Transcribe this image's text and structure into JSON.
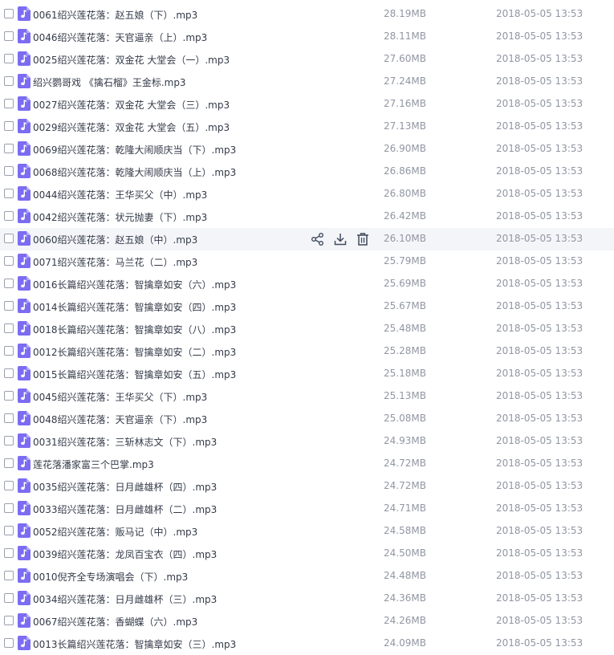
{
  "colors": {
    "icon_purple": "#7b6cf2",
    "text_primary": "#333a48",
    "text_secondary": "#9196a2",
    "hover_row": "#f4f5f9"
  },
  "icons": {
    "file": "audio-file-icon",
    "share": "share-icon",
    "download": "download-icon",
    "delete": "trash-icon"
  },
  "files": [
    {
      "name": "0061绍兴莲花落：赵五娘（下）.mp3",
      "size": "28.19MB",
      "date": "2018-05-05 13:53"
    },
    {
      "name": "0046绍兴莲花落：天官逼亲（上）.mp3",
      "size": "28.11MB",
      "date": "2018-05-05 13:53"
    },
    {
      "name": "0025绍兴莲花落：双金花  大堂会（一）.mp3",
      "size": "27.60MB",
      "date": "2018-05-05 13:53"
    },
    {
      "name": "绍兴鹦哥戏 《擒石榴》王金标.mp3",
      "size": "27.24MB",
      "date": "2018-05-05 13:53"
    },
    {
      "name": "0027绍兴莲花落：双金花  大堂会（三）.mp3",
      "size": "27.16MB",
      "date": "2018-05-05 13:53"
    },
    {
      "name": "0029绍兴莲花落：双金花  大堂会（五）.mp3",
      "size": "27.13MB",
      "date": "2018-05-05 13:53"
    },
    {
      "name": "0069绍兴莲花落：乾隆大闹顺庆当（下）.mp3",
      "size": "26.90MB",
      "date": "2018-05-05 13:53"
    },
    {
      "name": "0068绍兴莲花落：乾隆大闹顺庆当（上）.mp3",
      "size": "26.86MB",
      "date": "2018-05-05 13:53"
    },
    {
      "name": "0044绍兴莲花落：王华买父（中）.mp3",
      "size": "26.80MB",
      "date": "2018-05-05 13:53"
    },
    {
      "name": "0042绍兴莲花落：状元抛妻（下）.mp3",
      "size": "26.42MB",
      "date": "2018-05-05 13:53"
    },
    {
      "name": "0060绍兴莲花落：赵五娘（中）.mp3",
      "size": "26.10MB",
      "date": "2018-05-05 13:53"
    },
    {
      "name": "0071绍兴莲花落：马兰花（二）.mp3",
      "size": "25.79MB",
      "date": "2018-05-05 13:53"
    },
    {
      "name": "0016长篇绍兴莲花落：智擒章如安（六）.mp3",
      "size": "25.69MB",
      "date": "2018-05-05 13:53"
    },
    {
      "name": "0014长篇绍兴莲花落：智擒章如安（四）.mp3",
      "size": "25.67MB",
      "date": "2018-05-05 13:53"
    },
    {
      "name": "0018长篇绍兴莲花落：智擒章如安（八）.mp3",
      "size": "25.48MB",
      "date": "2018-05-05 13:53"
    },
    {
      "name": "0012长篇绍兴莲花落：智擒章如安（二）.mp3",
      "size": "25.28MB",
      "date": "2018-05-05 13:53"
    },
    {
      "name": "0015长篇绍兴莲花落：智擒章如安（五）.mp3",
      "size": "25.18MB",
      "date": "2018-05-05 13:53"
    },
    {
      "name": "0045绍兴莲花落：王华买父（下）.mp3",
      "size": "25.13MB",
      "date": "2018-05-05 13:53"
    },
    {
      "name": "0048绍兴莲花落：天官逼亲（下）.mp3",
      "size": "25.08MB",
      "date": "2018-05-05 13:53"
    },
    {
      "name": "0031绍兴莲花落：三斩林志文（下）.mp3",
      "size": "24.93MB",
      "date": "2018-05-05 13:53"
    },
    {
      "name": "莲花落潘家富三个巴掌.mp3",
      "size": "24.72MB",
      "date": "2018-05-05 13:53"
    },
    {
      "name": "0035绍兴莲花落：日月雌雄杯（四）.mp3",
      "size": "24.72MB",
      "date": "2018-05-05 13:53"
    },
    {
      "name": "0033绍兴莲花落：日月雌雄杯（二）.mp3",
      "size": "24.71MB",
      "date": "2018-05-05 13:53"
    },
    {
      "name": "0052绍兴莲花落：贩马记（中）.mp3",
      "size": "24.58MB",
      "date": "2018-05-05 13:53"
    },
    {
      "name": "0039绍兴莲花落：龙凤百宝衣（四）.mp3",
      "size": "24.50MB",
      "date": "2018-05-05 13:53"
    },
    {
      "name": "0010倪齐全专场演唱会（下）.mp3",
      "size": "24.48MB",
      "date": "2018-05-05 13:53"
    },
    {
      "name": "0034绍兴莲花落：日月雌雄杯（三）.mp3",
      "size": "24.36MB",
      "date": "2018-05-05 13:53"
    },
    {
      "name": "0067绍兴莲花落：香蝴蝶（六）.mp3",
      "size": "24.26MB",
      "date": "2018-05-05 13:53"
    },
    {
      "name": "0013长篇绍兴莲花落：智擒章如安（三）.mp3",
      "size": "24.09MB",
      "date": "2018-05-05 13:53"
    }
  ],
  "hovered_index": 10
}
